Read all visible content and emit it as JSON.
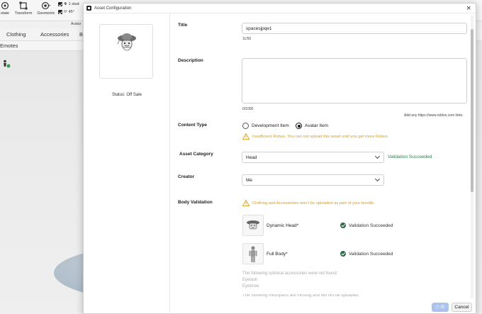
{
  "studio": {
    "toolbar": {
      "rotate_label": "otate",
      "transform_label": "Transform",
      "geometric_label": "Geometric",
      "stud_label": "1 stud",
      "angle_label": "45°"
    },
    "avatar_bar_label": "Avatar",
    "tabs": [
      "Clothing",
      "Accessories",
      "B"
    ],
    "emotes_label": "Emotes"
  },
  "dialog": {
    "title": "Asset Configuration",
    "status": "Status: Off Sale",
    "fields": {
      "title_label": "Title",
      "title_value": "spacesjpqe1",
      "title_count": "11/50",
      "description_label": "Description",
      "description_value": "",
      "description_count": "0/1000",
      "description_hint": "Add any https://www.roblox.com links",
      "content_type_label": "Content Type",
      "content_options": [
        "Development Item",
        "Avatar Item"
      ],
      "content_selected": "Avatar Item",
      "content_warning": "Insufficient Robux. You can not upload this asset until you get more Robux.",
      "asset_category_label": "Asset Category",
      "asset_category_value": "Head",
      "asset_category_status": "Validation Succeeded",
      "creator_label": "Creator",
      "creator_value": "Me",
      "body_validation_label": "Body Validation",
      "body_validation_warning": "Clothing and Accessories won't be uploaded as part of your bundle.",
      "body_items": [
        {
          "name": "Dynamic Head*",
          "status": "Validation Succeeded"
        },
        {
          "name": "Full Body*",
          "status": "Validation Succeeded"
        }
      ],
      "optional_note": "The following optional accessories were not found:",
      "optional_list": [
        "Eyelash",
        "Eyebrow"
      ],
      "cutoff_note": "The following meshparts are missing and will not be uploaded"
    },
    "buttons": {
      "ok_label": "ID",
      "cancel_label": "Cancel"
    }
  },
  "colors": {
    "validation_green": "#2e7d4f",
    "warning_yellow": "#d4a017",
    "primary_disabled": "#a9c3ee"
  }
}
